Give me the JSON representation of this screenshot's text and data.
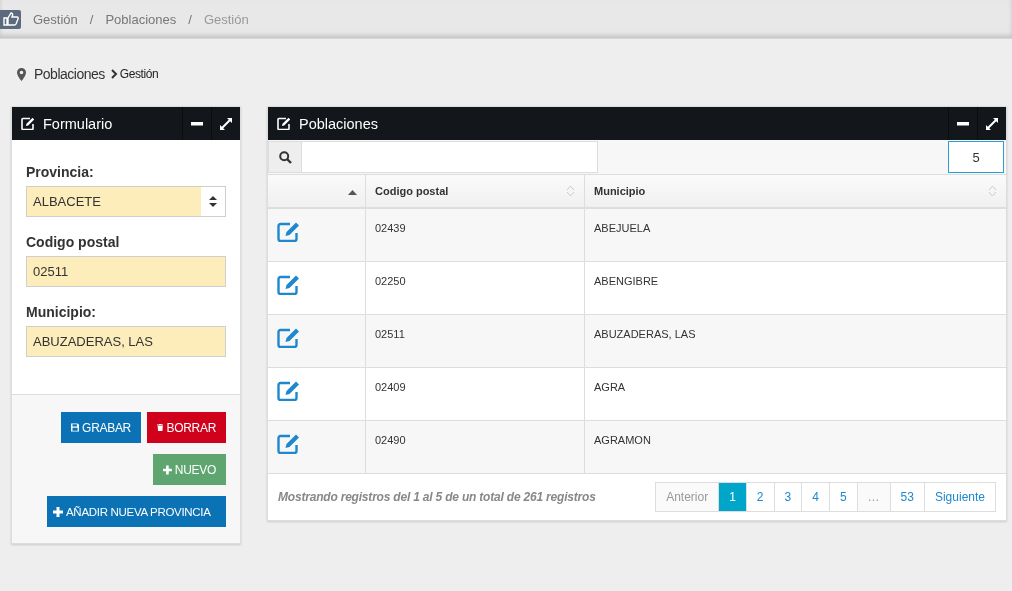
{
  "top_breadcrumb": [
    "Gestión",
    "Poblaciones",
    "Gestión"
  ],
  "breadcrumb_separator": "/",
  "page_path": {
    "section": "Poblaciones",
    "current": "Gestión"
  },
  "form_panel": {
    "title": "Formulario",
    "fields": [
      {
        "kind": "select",
        "label": "Provincia:",
        "value": "ALBACETE"
      },
      {
        "kind": "text",
        "label": "Codigo postal",
        "value": "02511"
      },
      {
        "kind": "text",
        "label": "Municipio:",
        "value": "ABUZADERAS, LAS"
      }
    ],
    "buttons": [
      {
        "kind": "save",
        "label": "GRABAR"
      },
      {
        "kind": "delete",
        "label": "BORRAR"
      },
      {
        "kind": "new",
        "label": "NUEVO"
      },
      {
        "kind": "add",
        "label": "AÑADIR NUEVA PROVINCIA"
      }
    ]
  },
  "table_panel": {
    "title": "Poblaciones",
    "page_size": "5",
    "columns": [
      "Codigo postal",
      "Municipio"
    ],
    "rows": [
      [
        "02439",
        "ABEJUELA"
      ],
      [
        "02250",
        "ABENGIBRE"
      ],
      [
        "02511",
        "ABUZADERAS, LAS"
      ],
      [
        "02409",
        "AGRA"
      ],
      [
        "02490",
        "AGRAMON"
      ]
    ],
    "info": "Mostrando registros del 1 al 5 de un total de 261 registros",
    "pagination": [
      {
        "label": "Anterior",
        "selected": false,
        "disabled": true
      },
      {
        "label": "1",
        "selected": true,
        "disabled": false
      },
      {
        "label": "2",
        "selected": false,
        "disabled": false
      },
      {
        "label": "3",
        "selected": false,
        "disabled": false
      },
      {
        "label": "4",
        "selected": false,
        "disabled": false
      },
      {
        "label": "5",
        "selected": false,
        "disabled": false
      },
      {
        "label": "…",
        "selected": false,
        "disabled": true
      },
      {
        "label": "53",
        "selected": false,
        "disabled": false
      },
      {
        "label": "Siguiente",
        "selected": false,
        "disabled": false
      }
    ]
  }
}
